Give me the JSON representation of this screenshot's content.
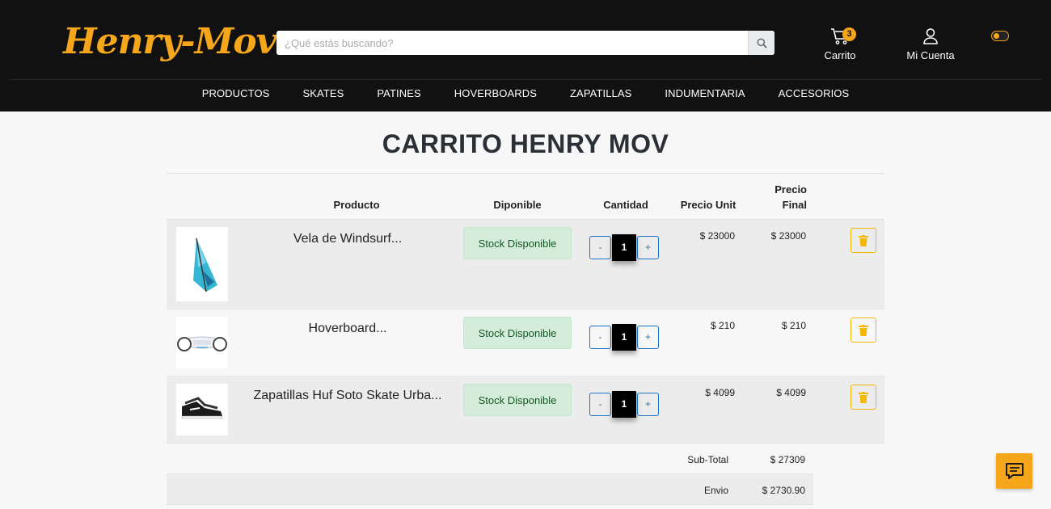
{
  "header": {
    "logo_text": "Henry-Mov",
    "search_placeholder": "¿Qué estás buscando?",
    "cart_label": "Carrito",
    "cart_count": "3",
    "account_label": "Mi Cuenta"
  },
  "nav": [
    "PRODUCTOS",
    "SKATES",
    "PATINES",
    "HOVERBOARDS",
    "ZAPATILLAS",
    "INDUMENTARIA",
    "ACCESORIOS"
  ],
  "page_title": "CARRITO HENRY MOV",
  "table": {
    "headers": {
      "producto": "Producto",
      "disponible": "Diponible",
      "cantidad": "Cantidad",
      "precio_unit": "Precio Unit",
      "precio_final_1": "Precio",
      "precio_final_2": "Final"
    },
    "rows": [
      {
        "name": "Vela de Windsurf...",
        "stock": "Stock Disponible",
        "qty_minus": "-",
        "qty": "1",
        "qty_plus": "+",
        "unit": "$ 23000",
        "final": "$ 23000",
        "icon": "windsurf-sail-image"
      },
      {
        "name": "Hoverboard...",
        "stock": "Stock Disponible",
        "qty_minus": "-",
        "qty": "1",
        "qty_plus": "+",
        "unit": "$ 210",
        "final": "$ 210",
        "icon": "hoverboard-image"
      },
      {
        "name": "Zapatillas Huf Soto Skate Urba...",
        "stock": "Stock Disponible",
        "qty_minus": "-",
        "qty": "1",
        "qty_plus": "+",
        "unit": "$ 4099",
        "final": "$ 4099",
        "icon": "sneaker-image"
      }
    ],
    "summary": {
      "subtotal_label": "Sub-Total",
      "subtotal_value": "$ 27309",
      "envio_label": "Envio",
      "envio_value": "$ 2730.90"
    }
  },
  "colors": {
    "accent": "#f5a61b",
    "header_bg": "#111111",
    "stock_bg": "#d4edda",
    "qty_blue": "#1a73c9"
  }
}
